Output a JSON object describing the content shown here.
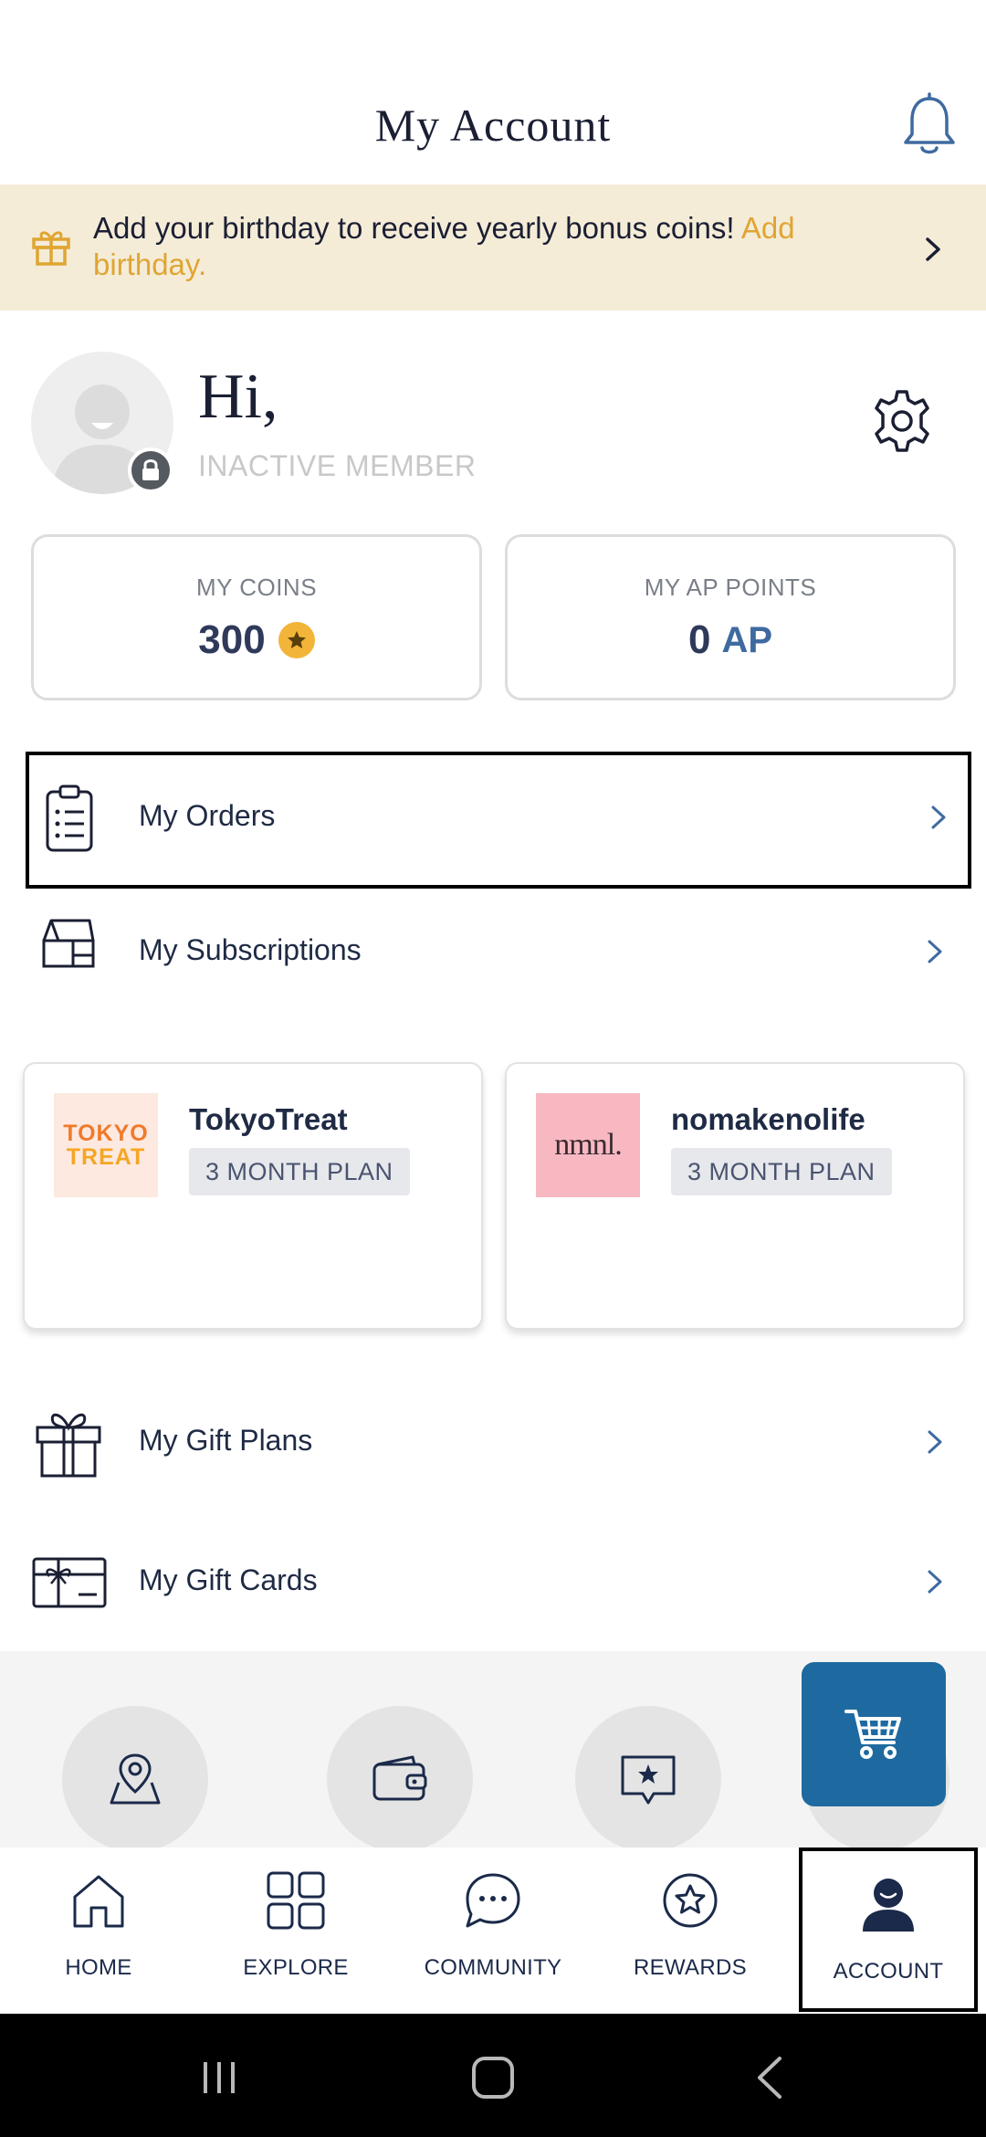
{
  "header": {
    "title": "My Account"
  },
  "banner": {
    "text": "Add your birthday to receive yearly bonus coins! ",
    "link": "Add birthday."
  },
  "profile": {
    "greeting": "Hi,",
    "status": "INACTIVE MEMBER"
  },
  "stats": {
    "coins_label": "MY COINS",
    "coins_value": "300",
    "ap_label": "MY AP POINTS",
    "ap_value": "0",
    "ap_unit": "AP"
  },
  "menu": {
    "orders": "My Orders",
    "subscriptions": "My Subscriptions",
    "gift_plans": "My Gift Plans",
    "gift_cards": "My Gift Cards"
  },
  "subscriptions": [
    {
      "name": "TokyoTreat",
      "plan": "3 MONTH PLAN",
      "logo_line1": "TOKYO",
      "logo_line2": "TREAT"
    },
    {
      "name": "nomakenolife",
      "plan": "3 MONTH PLAN",
      "logo_text": "nmnl."
    }
  ],
  "bottom_nav": {
    "items": [
      {
        "label": "HOME",
        "icon": "home-icon"
      },
      {
        "label": "EXPLORE",
        "icon": "grid-icon"
      },
      {
        "label": "COMMUNITY",
        "icon": "chat-icon"
      },
      {
        "label": "REWARDS",
        "icon": "star-badge-icon"
      },
      {
        "label": "ACCOUNT",
        "icon": "user-icon",
        "active": true
      }
    ]
  },
  "colors": {
    "banner_bg": "#f5ecd8",
    "banner_link": "#e0a532",
    "coin": "#f2b53a",
    "cart_button": "#1e6aa0",
    "navy": "#1b2a4a"
  }
}
